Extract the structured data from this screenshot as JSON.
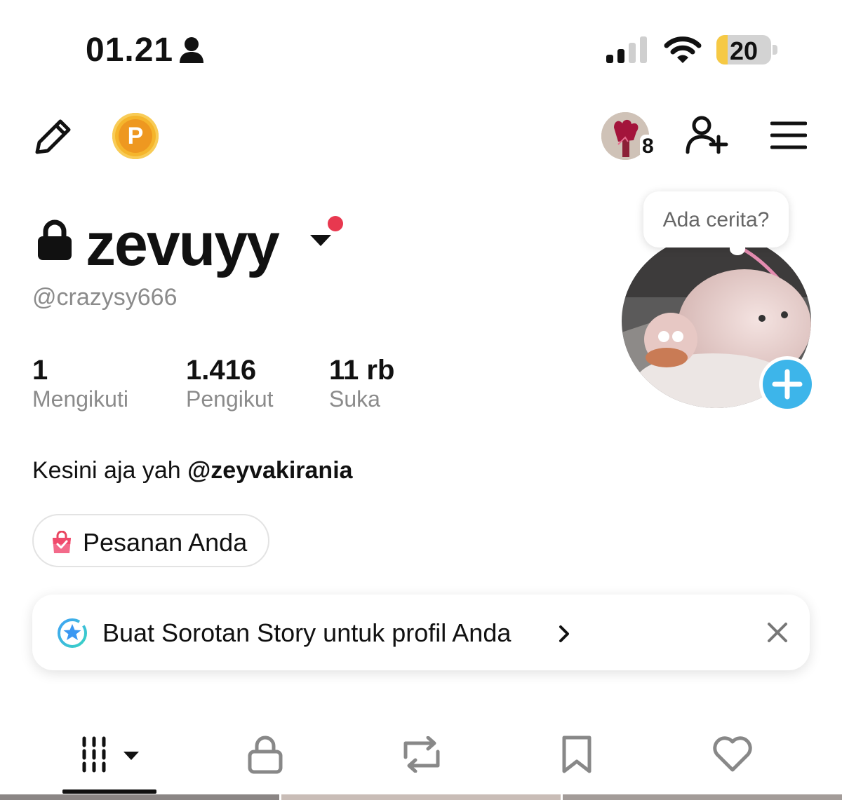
{
  "status_bar": {
    "time": "01.21",
    "battery": "20",
    "battery_level": 0.2
  },
  "profile": {
    "username": "zevuyy",
    "handle": "@crazysy666",
    "stats": [
      {
        "value": "1",
        "label": "Mengikuti"
      },
      {
        "value": "1.416",
        "label": "Pengikut"
      },
      {
        "value": "11 rb",
        "label": "Suka"
      }
    ],
    "bio_text": "Kesini aja yah ",
    "bio_mention": "@zeyvakirania",
    "story_prompt": "Ada cerita?",
    "mini_avatar_count": "8"
  },
  "orders_button": {
    "label": "Pesanan Anda"
  },
  "highlight_card": {
    "text": "Buat Sorotan Story untuk profil Anda"
  },
  "coin_label": "P",
  "colors": {
    "accent_blue": "#3db5ea",
    "notification_red": "#e8384f",
    "coin_gold": "#f5b52c",
    "battery_yellow": "#f6c944"
  },
  "icons": {
    "toolbar": [
      "pencil-icon",
      "coin-icon",
      "add-friend-icon",
      "menu-icon"
    ],
    "tabs": [
      "posts-grid-icon",
      "lock-icon",
      "repost-icon",
      "bookmark-icon",
      "heart-icon"
    ]
  }
}
